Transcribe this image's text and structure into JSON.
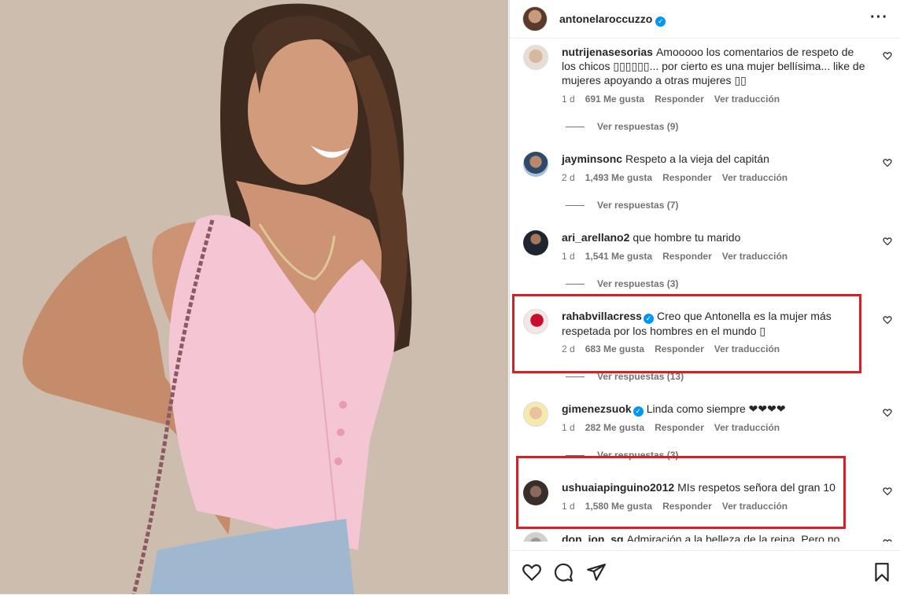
{
  "post": {
    "username": "antonelaroccuzzo",
    "more_icon": "more-horizontal-icon"
  },
  "colors": {
    "highlight": "#d61f26",
    "verified": "#0095f6",
    "text": "#262626",
    "muted": "#737373"
  },
  "comments": [
    {
      "user": "nutrijenasesorias",
      "verified": false,
      "text": "Amooooo los comentarios de respeto de los chicos ▯▯▯▯▯▯... por cierto es una mujer bellísima... like de mujeres apoyando a otras mujeres ▯▯",
      "age": "1 d",
      "likes": "691 Me gusta",
      "reply": "Responder",
      "translate": "Ver traducción",
      "replies": "Ver respuestas (9)"
    },
    {
      "user": "jayminsonc",
      "verified": false,
      "text": "Respeto a la vieja del capitán",
      "age": "2 d",
      "likes": "1,493 Me gusta",
      "reply": "Responder",
      "translate": "Ver traducción",
      "replies": "Ver respuestas (7)"
    },
    {
      "user": "ari_arellano2",
      "verified": false,
      "text": "que hombre tu marido",
      "age": "1 d",
      "likes": "1,541 Me gusta",
      "reply": "Responder",
      "translate": "Ver traducción",
      "replies": "Ver respuestas (3)"
    },
    {
      "user": "rahabvillacress",
      "verified": true,
      "text": "Creo que Antonella es la mujer más respetada por los hombres en el mundo ▯",
      "age": "2 d",
      "likes": "683 Me gusta",
      "reply": "Responder",
      "translate": "Ver traducción",
      "replies": "Ver respuestas (13)"
    },
    {
      "user": "gimenezsuok",
      "verified": true,
      "text": "Linda como siempre ❤❤❤❤",
      "age": "1 d",
      "likes": "282 Me gusta",
      "reply": "Responder",
      "translate": "Ver traducción",
      "replies": "Ver respuestas (3)"
    },
    {
      "user": "ushuaiapinguino2012",
      "verified": false,
      "text": "MIs respetos señora del gran 10",
      "age": "1 d",
      "likes": "1,580 Me gusta",
      "reply": "Responder",
      "translate": "Ver traducción"
    },
    {
      "user": "don_jon_sg",
      "verified": false,
      "text": "Admiración a la belleza de la reina. Pero no deseos."
    }
  ],
  "actions": {
    "like_icon": "heart-icon",
    "comment_icon": "comment-icon",
    "share_icon": "share-icon",
    "save_icon": "bookmark-icon"
  }
}
